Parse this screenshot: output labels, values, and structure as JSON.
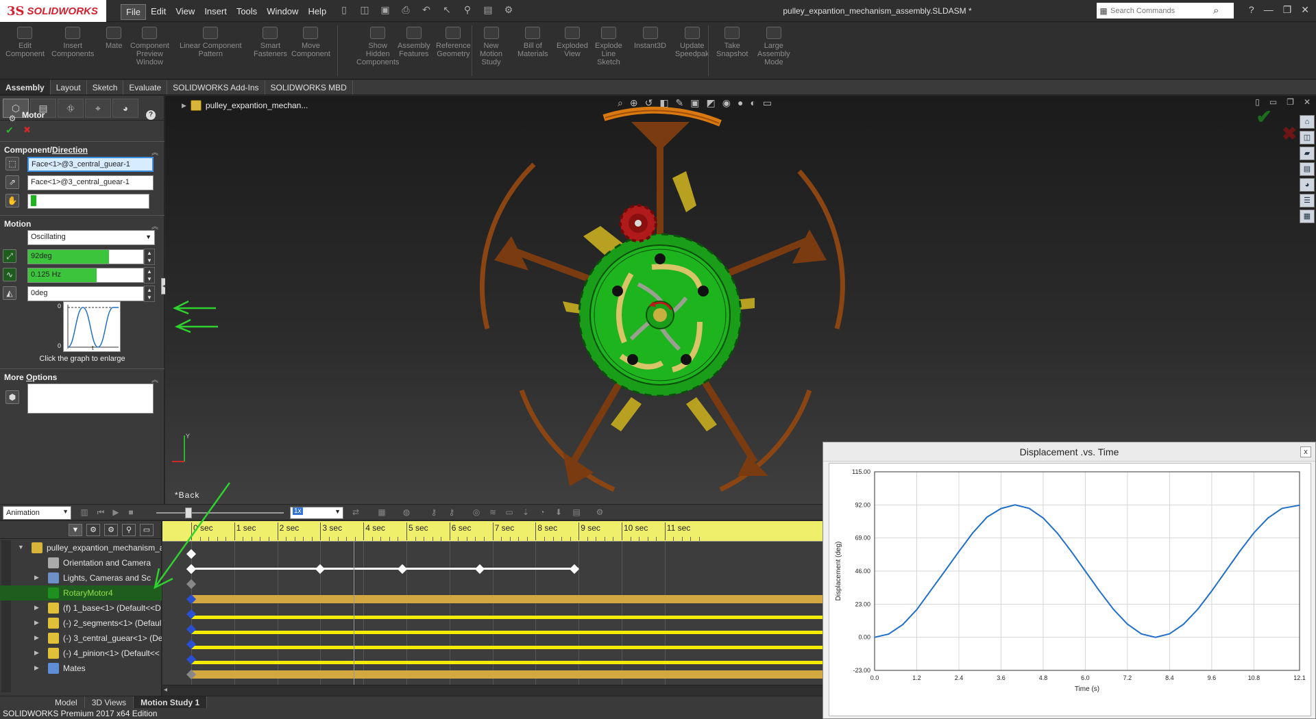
{
  "app": {
    "logo_prefix": "3S",
    "logo_name": "SOLIDWORKS",
    "document_title": "pulley_expantion_mechanism_assembly.SLDASM *",
    "search_placeholder": "Search Commands",
    "status_text": "SOLIDWORKS Premium 2017 x64 Edition"
  },
  "menu": [
    {
      "label": "File",
      "active": true
    },
    {
      "label": "Edit"
    },
    {
      "label": "View"
    },
    {
      "label": "Insert"
    },
    {
      "label": "Tools"
    },
    {
      "label": "Window"
    },
    {
      "label": "Help"
    }
  ],
  "commands": [
    {
      "label": "Edit\nComponent"
    },
    {
      "label": "Insert\nComponents"
    },
    {
      "label": "Mate"
    },
    {
      "label": "Component\nPreview\nWindow"
    },
    {
      "label": "Linear Component\nPattern"
    },
    {
      "label": "Smart\nFasteners"
    },
    {
      "label": "Move\nComponent"
    },
    {
      "label": "Show\nHidden\nComponents"
    },
    {
      "label": "Assembly\nFeatures"
    },
    {
      "label": "Reference\nGeometry"
    },
    {
      "label": "New\nMotion\nStudy"
    },
    {
      "label": "Bill of\nMaterials"
    },
    {
      "label": "Exploded\nView"
    },
    {
      "label": "Explode\nLine\nSketch"
    },
    {
      "label": "Instant3D"
    },
    {
      "label": "Update\nSpeedpak"
    },
    {
      "label": "Take\nSnapshot"
    },
    {
      "label": "Large\nAssembly\nMode"
    }
  ],
  "cm_tabs": [
    {
      "label": "Assembly",
      "active": true
    },
    {
      "label": "Layout"
    },
    {
      "label": "Sketch"
    },
    {
      "label": "Evaluate"
    },
    {
      "label": "SOLIDWORKS Add-Ins"
    },
    {
      "label": "SOLIDWORKS MBD"
    }
  ],
  "property_manager": {
    "title": "Motor",
    "help": "?",
    "ok": "✔",
    "cancel": "✖",
    "component_direction_label_a": "Component/",
    "component_direction_label_b": "Direction",
    "component_face": "Face<1>@3_central_guear-1",
    "direction_face": "Face<1>@3_central_guear-1",
    "motion_label": "Motion",
    "motion_type": "Oscillating",
    "displacement": "92deg",
    "frequency": "0.125 Hz",
    "phase": "0deg",
    "graph_y_top": "0",
    "graph_y_bottom": "0",
    "graph_x_label": "t",
    "graph_hint": "Click the graph to enlarge",
    "more_options_label_a": "More ",
    "more_options_label_b": "O",
    "more_options_label_c": "ptions"
  },
  "viewport": {
    "tree_root": "pulley_expantion_mechan...",
    "triad_y": "Y"
  },
  "graph_window": {
    "title": "Displacement .vs. Time",
    "close": "x"
  },
  "chart_data": {
    "type": "line",
    "title": "",
    "xlabel": "Time (s)",
    "ylabel": "Displacement (deg)",
    "xlim": [
      0.0,
      12.1
    ],
    "ylim": [
      -23.0,
      115.0
    ],
    "x_ticks": [
      "0.0",
      "1.2",
      "2.4",
      "3.6",
      "4.8",
      "6.0",
      "7.2",
      "8.4",
      "9.6",
      "10.8",
      "12.1"
    ],
    "y_ticks": [
      "115.00",
      "92.00",
      "69.00",
      "46.00",
      "23.00",
      "0.00",
      "-23.00"
    ],
    "grid": true,
    "line_color": "#1f6fc8",
    "series": [
      {
        "x": [
          0.0,
          0.4,
          0.8,
          1.2,
          1.6,
          2.0,
          2.4,
          2.8,
          3.2,
          3.6,
          4.0,
          4.4,
          4.8,
          5.2,
          5.6,
          6.0,
          6.4,
          6.8,
          7.2,
          7.6,
          8.0,
          8.4,
          8.8,
          9.2,
          9.6,
          10.0,
          10.4,
          10.8,
          11.2,
          11.6,
          12.1
        ],
        "y": [
          0.0,
          2.2,
          8.8,
          19.2,
          32.6,
          46.0,
          59.6,
          72.7,
          83.5,
          89.5,
          92.0,
          89.6,
          82.9,
          72.5,
          59.7,
          46.0,
          32.3,
          19.5,
          9.1,
          2.3,
          0.0,
          2.4,
          9.1,
          19.4,
          32.2,
          46.0,
          59.8,
          72.6,
          82.9,
          89.6,
          91.8
        ]
      }
    ]
  },
  "motion_study": {
    "study_type": "Animation",
    "slider_label": "*Back",
    "speed": "1x",
    "time_labels": [
      "0 sec",
      "1 sec",
      "2 sec",
      "3 sec",
      "4 sec",
      "5 sec",
      "6 sec",
      "7 sec",
      "8 sec",
      "9 sec",
      "10 sec",
      "11 sec"
    ],
    "tree": [
      {
        "label": "pulley_expantion_mechanism_a",
        "indent": 0,
        "expanded": true
      },
      {
        "label": "Orientation and Camera",
        "indent": 1
      },
      {
        "label": "Lights, Cameras and Sc",
        "indent": 1,
        "collapsed": true
      },
      {
        "label": "RotaryMotor4",
        "indent": 1,
        "highlight": true
      },
      {
        "label": "(f) 1_base<1> (Default<<D",
        "indent": 1,
        "collapsed": true
      },
      {
        "label": "(-) 2_segments<1> (Defaul",
        "indent": 1,
        "collapsed": true
      },
      {
        "label": "(-) 3_central_guear<1> (De",
        "indent": 1,
        "collapsed": true
      },
      {
        "label": "(-) 4_pinion<1> (Default<<",
        "indent": 1,
        "collapsed": true
      },
      {
        "label": "Mates",
        "indent": 1,
        "collapsed": true
      }
    ]
  },
  "bottom_tabs": [
    {
      "label": "Model"
    },
    {
      "label": "3D Views"
    },
    {
      "label": "Motion Study 1",
      "active": true
    }
  ],
  "colors": {
    "brand_red": "#d51e2e",
    "timeline_ruler": "#f0ef6b",
    "motor_bar": "#d4a840",
    "component_bar": "#f6ec00",
    "highlight_green": "#8fe04a",
    "gear_green": "#1a9e1a",
    "segment_brown": "#8b4513",
    "pinion_red": "#b01a1a"
  }
}
